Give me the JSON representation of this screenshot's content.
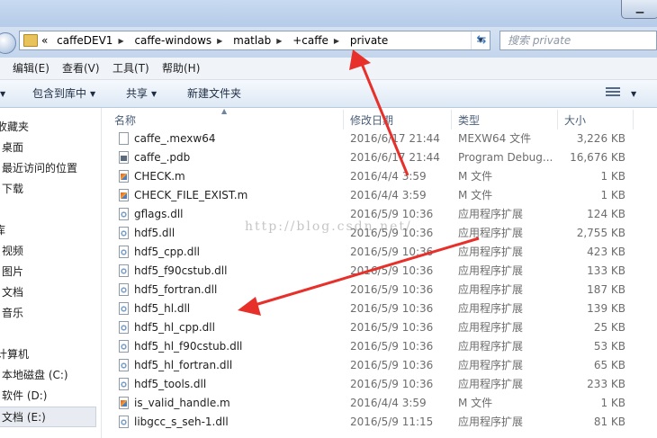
{
  "breadcrumb": {
    "overflow": "«",
    "items": [
      "caffeDEV1",
      "caffe-windows",
      "matlab",
      "+caffe",
      "private"
    ]
  },
  "search": {
    "placeholder": "搜索 private"
  },
  "menu": [
    "编辑(E)",
    "查看(V)",
    "工具(T)",
    "帮助(H)"
  ],
  "toolbar": {
    "include_library": "包含到库中",
    "share": "共享",
    "new_folder": "新建文件夹"
  },
  "sidebar": [
    "收藏夹",
    "桌面",
    "最近访问的位置",
    "下载",
    "库",
    "视频",
    "图片",
    "文档",
    "音乐",
    "计算机",
    "本地磁盘 (C:)",
    "软件 (D:)",
    "文档 (E:)"
  ],
  "columns": {
    "name": "名称",
    "date": "修改日期",
    "type": "类型",
    "size": "大小"
  },
  "files": [
    {
      "name": "caffe_.mexw64",
      "date": "2016/6/17 21:44",
      "type": "MEXW64 文件",
      "size": "3,226 KB",
      "icon": "blank-file-icon"
    },
    {
      "name": "caffe_.pdb",
      "date": "2016/6/17 21:44",
      "type": "Program Debug...",
      "size": "16,676 KB",
      "icon": "pdb-file-icon"
    },
    {
      "name": "CHECK.m",
      "date": "2016/4/4 3:59",
      "type": "M 文件",
      "size": "1 KB",
      "icon": "matlab-file-icon"
    },
    {
      "name": "CHECK_FILE_EXIST.m",
      "date": "2016/4/4 3:59",
      "type": "M 文件",
      "size": "1 KB",
      "icon": "matlab-file-icon"
    },
    {
      "name": "gflags.dll",
      "date": "2016/5/9 10:36",
      "type": "应用程序扩展",
      "size": "124 KB",
      "icon": "dll-file-icon"
    },
    {
      "name": "hdf5.dll",
      "date": "2016/5/9 10:36",
      "type": "应用程序扩展",
      "size": "2,755 KB",
      "icon": "dll-file-icon"
    },
    {
      "name": "hdf5_cpp.dll",
      "date": "2016/5/9 10:36",
      "type": "应用程序扩展",
      "size": "423 KB",
      "icon": "dll-file-icon"
    },
    {
      "name": "hdf5_f90cstub.dll",
      "date": "2016/5/9 10:36",
      "type": "应用程序扩展",
      "size": "133 KB",
      "icon": "dll-file-icon"
    },
    {
      "name": "hdf5_fortran.dll",
      "date": "2016/5/9 10:36",
      "type": "应用程序扩展",
      "size": "187 KB",
      "icon": "dll-file-icon"
    },
    {
      "name": "hdf5_hl.dll",
      "date": "2016/5/9 10:36",
      "type": "应用程序扩展",
      "size": "139 KB",
      "icon": "dll-file-icon"
    },
    {
      "name": "hdf5_hl_cpp.dll",
      "date": "2016/5/9 10:36",
      "type": "应用程序扩展",
      "size": "25 KB",
      "icon": "dll-file-icon"
    },
    {
      "name": "hdf5_hl_f90cstub.dll",
      "date": "2016/5/9 10:36",
      "type": "应用程序扩展",
      "size": "53 KB",
      "icon": "dll-file-icon"
    },
    {
      "name": "hdf5_hl_fortran.dll",
      "date": "2016/5/9 10:36",
      "type": "应用程序扩展",
      "size": "65 KB",
      "icon": "dll-file-icon"
    },
    {
      "name": "hdf5_tools.dll",
      "date": "2016/5/9 10:36",
      "type": "应用程序扩展",
      "size": "233 KB",
      "icon": "dll-file-icon"
    },
    {
      "name": "is_valid_handle.m",
      "date": "2016/4/4 3:59",
      "type": "M 文件",
      "size": "1 KB",
      "icon": "matlab-file-icon"
    },
    {
      "name": "libgcc_s_seh-1.dll",
      "date": "2016/5/9 11:15",
      "type": "应用程序扩展",
      "size": "81 KB",
      "icon": "dll-file-icon"
    }
  ],
  "watermark": "http://blog.csdn.net/",
  "annotation_color": "#e8302a"
}
